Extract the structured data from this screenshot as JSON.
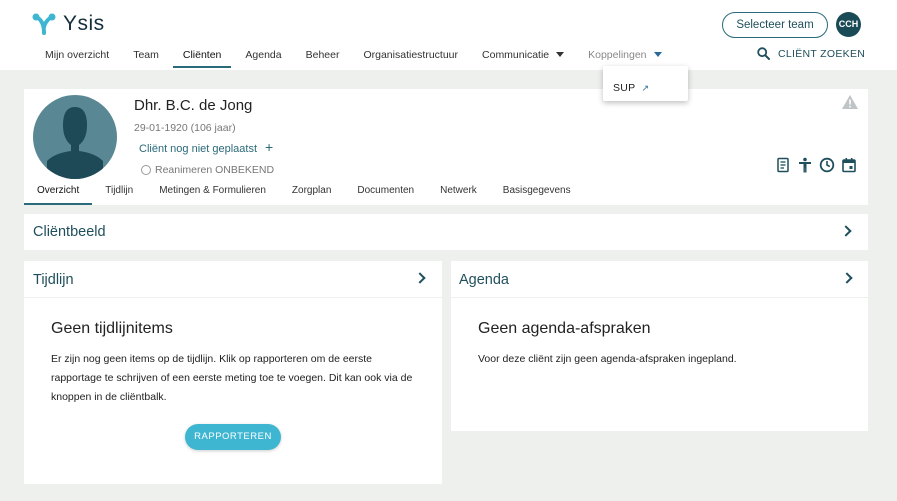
{
  "app": {
    "logo_text": "Ysis"
  },
  "nav": {
    "items": [
      {
        "label": "Mijn overzicht"
      },
      {
        "label": "Team"
      },
      {
        "label": "Cliënten"
      },
      {
        "label": "Agenda"
      },
      {
        "label": "Beheer"
      },
      {
        "label": "Organisatiestructuur"
      },
      {
        "label": "Communicatie"
      },
      {
        "label": "Koppelingen"
      }
    ]
  },
  "header": {
    "select_team": "Selecteer team",
    "user_initials": "CCH",
    "client_search": "CLIËNT ZOEKEN"
  },
  "dropdown": {
    "item": "SUP",
    "ext_symbol": "↗"
  },
  "client": {
    "name": "Dhr. B.C. de Jong",
    "dob": "29-01-1920 (106 jaar)",
    "placement": "Cliënt nog niet geplaatst",
    "placement_add": "+",
    "reanimate": "Reanimeren ONBEKEND"
  },
  "subtabs": [
    {
      "label": "Overzicht"
    },
    {
      "label": "Tijdlijn"
    },
    {
      "label": "Metingen & Formulieren"
    },
    {
      "label": "Zorgplan"
    },
    {
      "label": "Documenten"
    },
    {
      "label": "Netwerk"
    },
    {
      "label": "Basisgegevens"
    }
  ],
  "sections": {
    "clientbeeld": {
      "title": "Cliëntbeeld"
    },
    "tijdlijn": {
      "title": "Tijdlijn",
      "empty_title": "Geen tijdlijnitems",
      "empty_text": "Er zijn nog geen items op de tijdlijn. Klik op rapporteren om de eerste rapportage te schrijven of een eerste meting toe te voegen. Dit kan ook via de knoppen in de cliëntbalk.",
      "button": "RAPPORTEREN"
    },
    "agenda": {
      "title": "Agenda",
      "empty_title": "Geen agenda-afspraken",
      "empty_text": "Voor deze cliënt zijn geen agenda-afspraken ingepland."
    }
  },
  "colors": {
    "accent": "#2a6a7a",
    "button": "#3eb6d2",
    "background": "#eef0ed"
  }
}
